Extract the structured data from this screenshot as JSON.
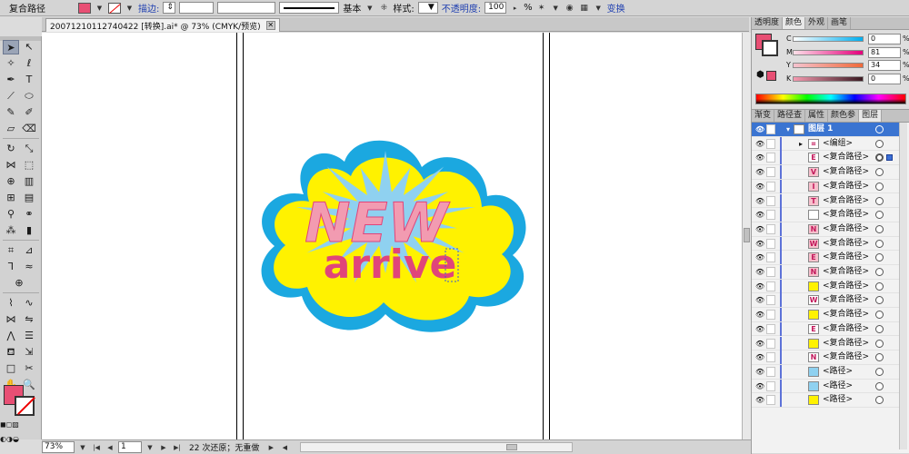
{
  "control_bar": {
    "selection_type": "复合路径",
    "fill_color": "#e84f74",
    "stroke_label": "描边:",
    "profile_label": "基本",
    "style_label": "样式:",
    "opacity_label": "不透明度:",
    "opacity_value": "100",
    "opacity_unit": "%",
    "transform_label": "变换"
  },
  "document": {
    "tab_title": "20071210112740422 [转换].ai* @ 73% (CMYK/预览)",
    "close_glyph": "✕"
  },
  "artwork": {
    "headline": "NEW",
    "subline": "arrive",
    "cloud_fill": "#fff200",
    "cloud_stroke": "#1ba8e0",
    "burst_color": "#8fd1f0",
    "headline_color": "#f29bb1",
    "subline_color": "#e0457a"
  },
  "status_bar": {
    "zoom": "73%",
    "page": "1",
    "status": "22 次还原；无重做"
  },
  "color_panel": {
    "tabs": [
      "透明度",
      "颜色",
      "外观",
      "画笔"
    ],
    "active_tab": "颜色",
    "channels": [
      {
        "letter": "C",
        "value": "0"
      },
      {
        "letter": "M",
        "value": "81"
      },
      {
        "letter": "Y",
        "value": "34"
      },
      {
        "letter": "K",
        "value": "0"
      }
    ],
    "percent": "%"
  },
  "layers_panel": {
    "tabs": [
      "渐变",
      "路径查",
      "属性",
      "颜色参",
      "图层"
    ],
    "active_tab": "图层",
    "layer_name": "图层 1",
    "items": [
      "<编组>",
      "<复合路径>",
      "<复合路径>",
      "<复合路径>",
      "<复合路径>",
      "<复合路径>",
      "<复合路径>",
      "<复合路径>",
      "<复合路径>",
      "<复合路径>",
      "<复合路径>",
      "<复合路径>",
      "<复合路径>",
      "<复合路径>",
      "<复合路径>",
      "<复合路径>",
      "<路径>",
      "<路径>",
      "<路径>"
    ]
  }
}
